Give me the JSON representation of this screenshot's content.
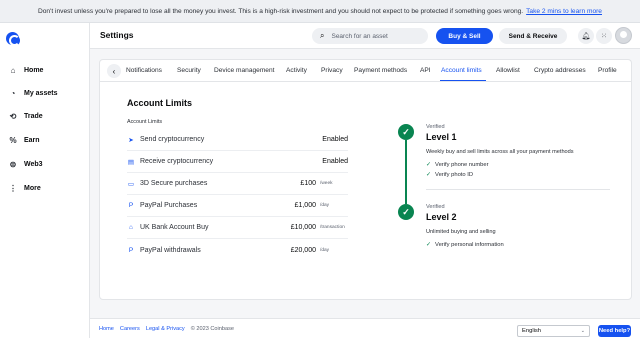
{
  "banner": {
    "text": "Don't invest unless you're prepared to lose all the money you invest. This is a high-risk investment and you should not expect to be protected if something goes wrong.",
    "link": "Take 2 mins to learn more"
  },
  "sidebar": {
    "logo_icon": "coinbase-logo",
    "items": [
      {
        "label": "Home",
        "icon": "home-icon"
      },
      {
        "label": "My assets",
        "icon": "assets-icon"
      },
      {
        "label": "Trade",
        "icon": "trade-icon"
      },
      {
        "label": "Earn",
        "icon": "percent-icon"
      },
      {
        "label": "Web3",
        "icon": "web3-icon"
      },
      {
        "label": "More",
        "icon": "more-icon"
      }
    ]
  },
  "header": {
    "title": "Settings",
    "search_placeholder": "Search for an asset",
    "buy_sell": "Buy & Sell",
    "send_receive": "Send & Receive",
    "accent": "#1652f0"
  },
  "tabs": [
    {
      "label": "Notifications"
    },
    {
      "label": "Security"
    },
    {
      "label": "Device management"
    },
    {
      "label": "Activity"
    },
    {
      "label": "Privacy"
    },
    {
      "label": "Payment methods"
    },
    {
      "label": "API"
    },
    {
      "label": "Account limits",
      "active": true
    },
    {
      "label": "Allowlist"
    },
    {
      "label": "Crypto addresses"
    },
    {
      "label": "Profile"
    }
  ],
  "limits": {
    "title": "Account Limits",
    "subtitle": "Account Limits",
    "rows": [
      {
        "label": "Send cryptocurrency",
        "value": "Enabled",
        "period": "",
        "icon": "send-icon"
      },
      {
        "label": "Receive cryptocurrency",
        "value": "Enabled",
        "period": "",
        "icon": "receive-icon"
      },
      {
        "label": "3D Secure purchases",
        "value": "£100",
        "period": "/week",
        "icon": "card-icon"
      },
      {
        "label": "PayPal Purchases",
        "value": "£1,000",
        "period": "/day",
        "icon": "paypal-icon"
      },
      {
        "label": "UK Bank Account Buy",
        "value": "£10,000",
        "period": "/transaction",
        "icon": "bank-icon"
      },
      {
        "label": "PayPal withdrawals",
        "value": "£20,000",
        "period": "/day",
        "icon": "paypal-icon"
      }
    ]
  },
  "levels": [
    {
      "tag": "Verified",
      "title": "Level 1",
      "description": "Weekly buy and sell limits across all your payment methods",
      "items": [
        "Verify phone number",
        "Verify photo ID"
      ]
    },
    {
      "tag": "Verified",
      "title": "Level 2",
      "description": "Unlimited buying and selling",
      "items": [
        "Verify personal information"
      ]
    }
  ],
  "verified_color": "#098551",
  "footer": {
    "links": [
      "Home",
      "Careers",
      "Legal & Privacy"
    ],
    "copyright": "© 2023 Coinbase",
    "language": "English",
    "help": "Need help?"
  }
}
